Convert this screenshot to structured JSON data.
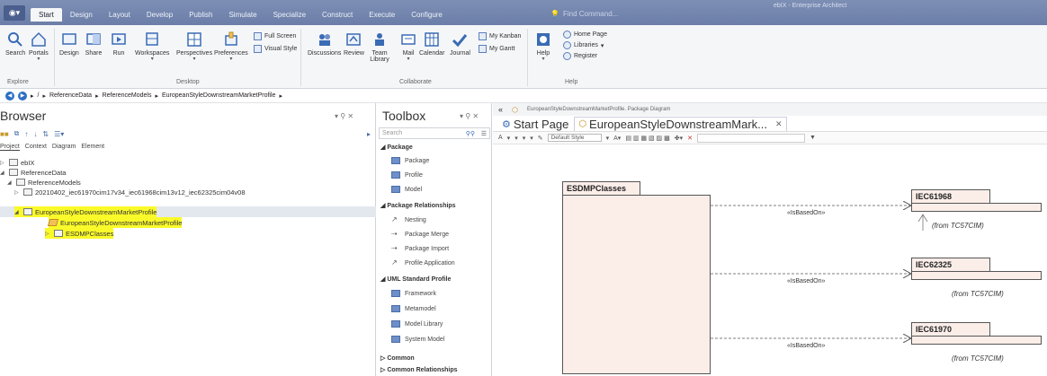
{
  "window": {
    "title": "ebIX - Enterprise Architect"
  },
  "menu": {
    "tabs": [
      "Start",
      "Design",
      "Layout",
      "Develop",
      "Publish",
      "Simulate",
      "Specialize",
      "Construct",
      "Execute",
      "Configure"
    ],
    "find_command": "Find Command..."
  },
  "ribbon": {
    "explore": {
      "label": "Explore",
      "buttons": [
        "Search",
        "Portals"
      ]
    },
    "desktop": {
      "label": "Desktop",
      "buttons": [
        "Design",
        "Share",
        "Run",
        "Workspaces",
        "Perspectives",
        "Preferences"
      ],
      "small": [
        "Full Screen",
        "Visual Style"
      ]
    },
    "collaborate": {
      "label": "Collaborate",
      "buttons": [
        "Discussions",
        "Review",
        "Team Library",
        "Mail",
        "Calendar",
        "Journal"
      ],
      "small": [
        "My Kanban",
        "My Gantt"
      ]
    },
    "help": {
      "label": "Help",
      "buttons": [
        "Help"
      ],
      "small": [
        "Home Page",
        "Libraries",
        "Register"
      ]
    }
  },
  "breadcrumb": [
    "ReferenceData",
    "ReferenceModels",
    "EuropeanStyleDownstreamMarketProfile"
  ],
  "browser": {
    "title": "Browser",
    "tabs": [
      "Project",
      "Context",
      "Diagram",
      "Element"
    ],
    "tree": [
      {
        "label": "ebIX"
      },
      {
        "label": "ReferenceData"
      },
      {
        "label": "ReferenceModels"
      },
      {
        "label": "20210402_iec61970cim17v34_iec61968cim13v12_iec62325cim04v08"
      },
      {
        "label": "EuropeanStyleDownstreamMarketProfile"
      },
      {
        "label": "EuropeanStyleDownstreamMarketProfile"
      },
      {
        "label": "ESDMPClasses"
      }
    ]
  },
  "toolbox": {
    "title": "Toolbox",
    "search_placeholder": "Search",
    "sections": [
      {
        "name": "Package",
        "items": [
          "Package",
          "Profile",
          "Model"
        ]
      },
      {
        "name": "Package Relationships",
        "items": [
          "Nesting",
          "Package Merge",
          "Package Import",
          "Profile Application"
        ]
      },
      {
        "name": "UML Standard Profile",
        "items": [
          "Framework",
          "Metamodel",
          "Model Library",
          "System Model"
        ]
      },
      {
        "name": "Common",
        "items": []
      },
      {
        "name": "Common Relationships",
        "items": []
      }
    ]
  },
  "diagram": {
    "path": "EuropeanStyleDownstreamMarketProfile.  Package Diagram",
    "tabs": [
      "Start Page",
      "EuropeanStyleDownstreamMark..."
    ],
    "style": "Default Style",
    "elements": {
      "main": "ESDMPClasses",
      "targets": [
        {
          "name": "IEC61968",
          "from": "(from TC57CIM)"
        },
        {
          "name": "IEC62325",
          "from": "(from TC57CIM)"
        },
        {
          "name": "IEC61970",
          "from": "(from TC57CIM)"
        }
      ]
    },
    "relations": [
      "«IsBasedOn»",
      "«IsBasedOn»",
      "«IsBasedOn»"
    ]
  },
  "colors": {
    "accent": "#2f6fc4",
    "menubar": "#7083ad",
    "package_fill": "#fbeee9",
    "highlight": "#fafa2a"
  }
}
